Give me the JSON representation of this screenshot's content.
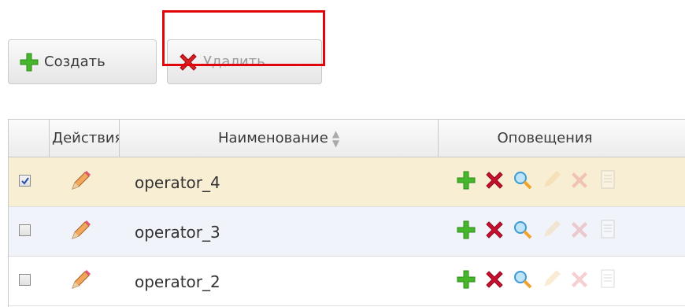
{
  "toolbar": {
    "create_label": "Создать",
    "delete_label": "Удалить"
  },
  "grid": {
    "columns": {
      "actions": "Действия",
      "name": "Наименование",
      "notifications": "Оповещения"
    },
    "rows": [
      {
        "name": "operator_4",
        "checked": true
      },
      {
        "name": "operator_3",
        "checked": false
      },
      {
        "name": "operator_2",
        "checked": false
      }
    ]
  },
  "colors": {
    "highlight_box": "#e1060c",
    "selected_row": "#f8eed3",
    "alt_row": "#f0f4fa",
    "add_green": "#3cb521",
    "delete_red": "#c8102e"
  },
  "icons": [
    "plus-icon",
    "delete-icon",
    "search-icon",
    "edit-icon",
    "pencil-icon",
    "document-icon",
    "checkbox-icon"
  ]
}
